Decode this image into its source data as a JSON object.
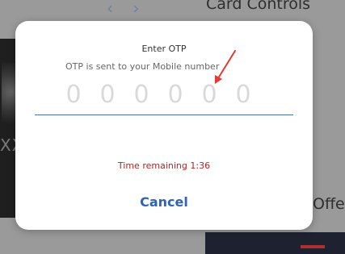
{
  "background": {
    "nav_prev": "‹",
    "nav_next": "›",
    "page_title": "Card Controls",
    "card_text": "XX",
    "offers_text": "Offe"
  },
  "otp_dialog": {
    "title": "Enter OTP",
    "subtitle": "OTP is sent to your Mobile number",
    "digits": [
      "0",
      "0",
      "0",
      "0",
      "0",
      "0"
    ],
    "timer_text": "Time remaining 1:36",
    "cancel_label": "Cancel"
  },
  "colors": {
    "accent": "#2f64b5",
    "timer": "#b22222",
    "annotation_arrow": "#e53935"
  }
}
